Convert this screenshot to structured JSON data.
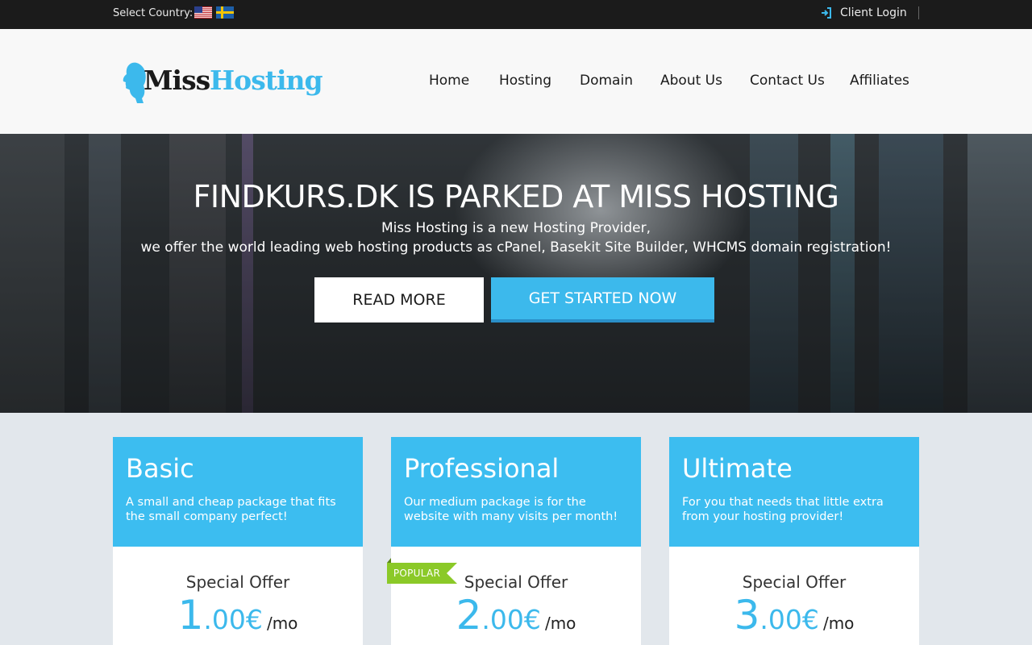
{
  "topbar": {
    "country_label": "Select Country:",
    "flags": [
      "us-flag-icon",
      "sweden-flag-icon"
    ],
    "login_label": "Client Login",
    "login_icon": "sign-in-icon"
  },
  "header": {
    "logo_text_1": "Miss",
    "logo_text_2": "Hosting",
    "nav": [
      "Home",
      "Hosting",
      "Domain",
      "About Us",
      "Contact Us",
      "Affiliates"
    ]
  },
  "hero": {
    "title": "FINDKURS.DK IS PARKED AT MISS HOSTING",
    "line1": "Miss Hosting is a new Hosting Provider,",
    "line2": "we offer the world leading web hosting products as cPanel, Basekit Site Builder, WHCMS domain registration!",
    "read_more": "READ MORE",
    "get_started": "GET STARTED NOW"
  },
  "plans": [
    {
      "name": "Basic",
      "description": "A small and cheap package that fits the small company perfect!",
      "offer": "Special Offer",
      "price_int": "1",
      "price_dec": ".00€",
      "per": "/mo"
    },
    {
      "name": "Professional",
      "description": "Our medium package is for the website with many visits per month!",
      "offer": "Special Offer",
      "price_int": "2",
      "price_dec": ".00€",
      "per": "/mo",
      "badge": "POPULAR"
    },
    {
      "name": "Ultimate",
      "description": "For you that needs that little extra from your hosting provider!",
      "offer": "Special Offer",
      "price_int": "3",
      "price_dec": ".00€",
      "per": "/mo"
    }
  ],
  "colors": {
    "accent": "#3cb9ec",
    "topbar": "#1b1b1b",
    "badge": "#8bc928"
  }
}
